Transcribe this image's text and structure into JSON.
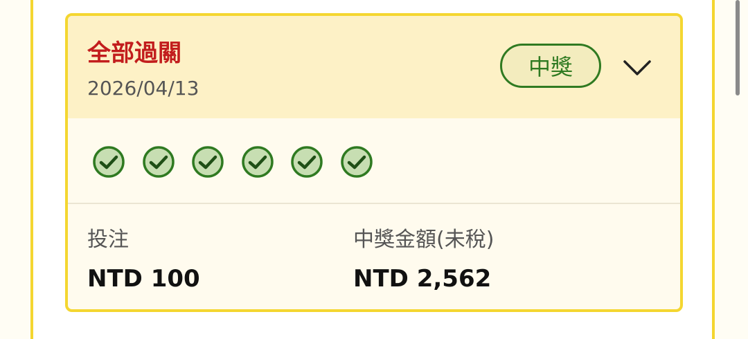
{
  "ticket": {
    "title": "全部過關",
    "date": "2026/04/13",
    "status_badge": "中獎",
    "expand_icon": "chevron-down-icon",
    "results": [
      {
        "icon": "check-circle-icon",
        "correct": true
      },
      {
        "icon": "check-circle-icon",
        "correct": true
      },
      {
        "icon": "check-circle-icon",
        "correct": true
      },
      {
        "icon": "check-circle-icon",
        "correct": true
      },
      {
        "icon": "check-circle-icon",
        "correct": true
      },
      {
        "icon": "check-circle-icon",
        "correct": true
      }
    ],
    "stake": {
      "label": "投注",
      "value": "NTD 100"
    },
    "payout": {
      "label": "中獎金額(未稅)",
      "value": "NTD 2,562"
    }
  },
  "colors": {
    "accent_border": "#f4d630",
    "header_bg": "#fdf1c6",
    "title_red": "#c21d1d",
    "win_green": "#2f7a21"
  }
}
